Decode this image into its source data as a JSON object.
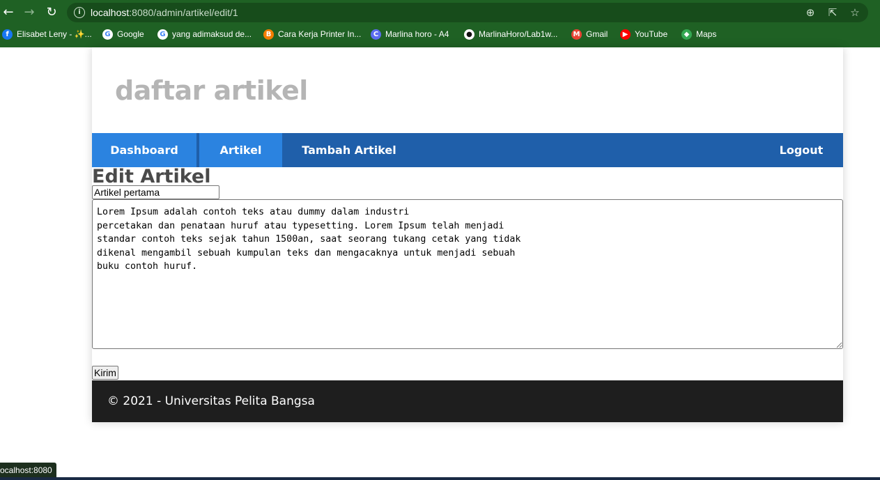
{
  "browser": {
    "url_host": "localhost",
    "url_rest": ":8080/admin/artikel/edit/1",
    "bookmarks": [
      {
        "label": "Elisabet Leny - ✨...",
        "icon": "facebook-icon",
        "color": "#1877f2"
      },
      {
        "label": "Google",
        "icon": "google-icon",
        "color": "#ffffff"
      },
      {
        "label": "yang adimaksud de...",
        "icon": "google-icon",
        "color": "#ffffff"
      },
      {
        "label": "Cara Kerja Printer In...",
        "icon": "blogger-icon",
        "color": "#f57d00"
      },
      {
        "label": "Marlina horo - A4",
        "icon": "canva-icon",
        "color": "#5b6cf0"
      },
      {
        "label": "MarlinaHoro/Lab1w...",
        "icon": "github-icon",
        "color": "#ffffff"
      },
      {
        "label": "Gmail",
        "icon": "gmail-icon",
        "color": "#ea4335"
      },
      {
        "label": "YouTube",
        "icon": "youtube-icon",
        "color": "#ff0000"
      },
      {
        "label": "Maps",
        "icon": "maps-icon",
        "color": "#34a853"
      }
    ]
  },
  "header": {
    "title": "daftar artikel"
  },
  "nav": {
    "dashboard": "Dashboard",
    "artikel": "Artikel",
    "tambah": "Tambah Artikel",
    "logout": "Logout"
  },
  "form": {
    "heading": "Edit Artikel",
    "title_value": "Artikel pertama",
    "content_value": "Lorem Ipsum adalah contoh teks atau dummy dalam industri\npercetakan dan penataan huruf atau typesetting. Lorem Ipsum telah menjadi\nstandar contoh teks sejak tahun 1500an, saat seorang tukang cetak yang tidak\ndikenal mengambil sebuah kumpulan teks dan mengacaknya untuk menjadi sebuah\nbuku contoh huruf.",
    "submit_label": "Kirim"
  },
  "footer": {
    "text": "© 2021 - Universitas Pelita Bangsa"
  },
  "status": {
    "text": "ocalhost:8080"
  }
}
